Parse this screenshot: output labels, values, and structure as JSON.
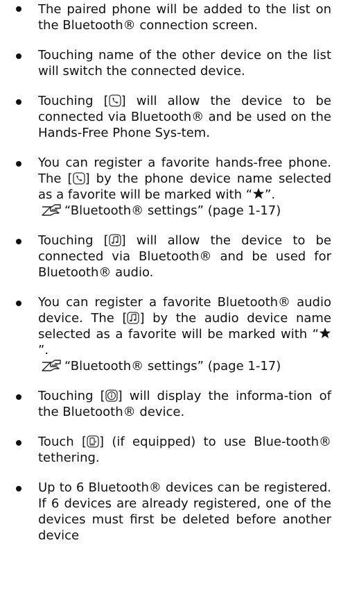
{
  "items": [
    {
      "text": "The paired phone will be added to the list on the Bluetooth® connection screen."
    },
    {
      "text": "Touching name of the other device on the list will switch the connected device."
    },
    {
      "pre": "Touching [",
      "icon": "phone-icon",
      "post": "] will allow the device to be connected via Bluetooth® and be used on the Hands-Free Phone Sys-tem."
    },
    {
      "pre": "You can register a favorite hands-free phone. The [",
      "icon": "phone-icon",
      "post": "] by the phone device name selected as a favorite will be marked with “",
      "post2": "”.",
      "ref": "“Bluetooth® settings” (page 1-17)"
    },
    {
      "pre": "Touching [",
      "icon": "music-icon",
      "post": "] will allow the device to be connected via Bluetooth® and be used for Bluetooth® audio."
    },
    {
      "pre": "You can register a favorite Bluetooth® audio device. The [",
      "icon": "music-icon",
      "post": "] by the audio device name selected as a favorite will be marked with “",
      "post2": "”.",
      "ref": "“Bluetooth® settings” (page 1-17)"
    },
    {
      "pre": "Touching [",
      "icon": "info-icon",
      "post": "] will display the informa-tion of the Bluetooth® device."
    },
    {
      "pre": "Touch [",
      "icon": "tethering-icon",
      "post": "] (if equipped) to use Blue-tooth® tethering."
    },
    {
      "text": "Up to 6 Bluetooth® devices can be registered. If 6 devices are already registered, one of the devices must first be deleted before another device"
    }
  ]
}
